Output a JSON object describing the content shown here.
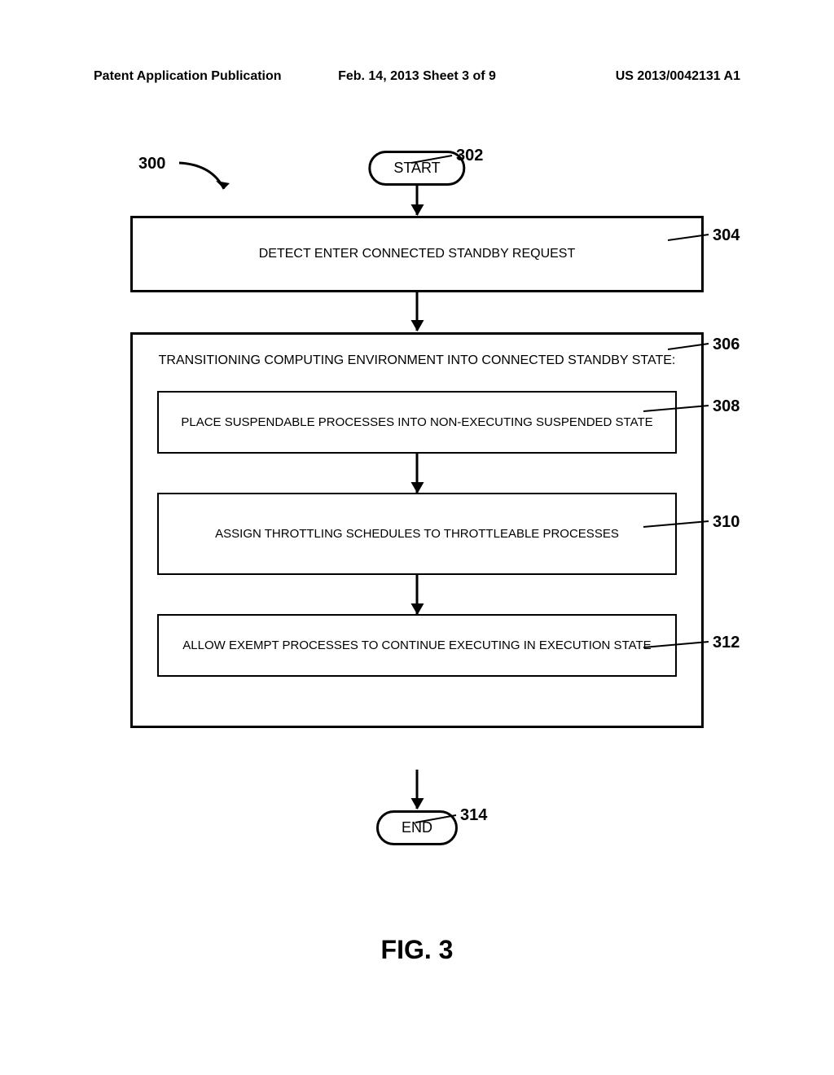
{
  "header": {
    "left": "Patent Application Publication",
    "center": "Feb. 14, 2013  Sheet 3 of 9",
    "right": "US 2013/0042131 A1"
  },
  "labels": {
    "ref300": "300",
    "ref302": "302",
    "ref304": "304",
    "ref306": "306",
    "ref308": "308",
    "ref310": "310",
    "ref312": "312",
    "ref314": "314"
  },
  "boxes": {
    "start": "START",
    "step304": "DETECT ENTER CONNECTED STANDBY REQUEST",
    "step306_title": "TRANSITIONING COMPUTING ENVIRONMENT INTO CONNECTED STANDBY STATE:",
    "step308": "PLACE SUSPENDABLE PROCESSES INTO NON-EXECUTING SUSPENDED STATE",
    "step310": "ASSIGN THROTTLING SCHEDULES TO THROTTLEABLE PROCESSES",
    "step312": "ALLOW EXEMPT PROCESSES TO CONTINUE EXECUTING IN EXECUTION STATE",
    "end": "END"
  },
  "figure": "FIG. 3"
}
